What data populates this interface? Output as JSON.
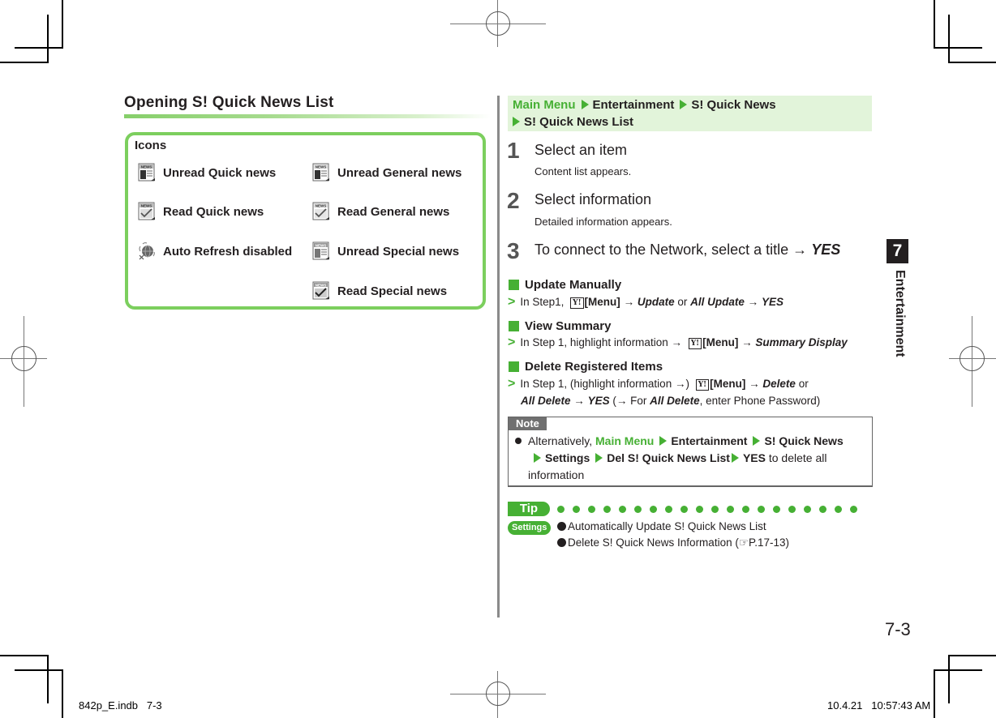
{
  "left_section": {
    "title": "Opening S! Quick News List",
    "icons_box": {
      "heading": "Icons",
      "items": [
        {
          "icon": "newspaper-unread-icon",
          "label": "Unread Quick news"
        },
        {
          "icon": "newspaper-read-icon",
          "label": "Read Quick news"
        },
        {
          "icon": "globe-disabled-icon",
          "label": "Auto Refresh disabled"
        },
        {
          "icon": "newspaper-unread-icon",
          "label": "Unread General news"
        },
        {
          "icon": "newspaper-read-icon",
          "label": "Read General news"
        },
        {
          "icon": "newspaper-unread-icon",
          "label": "Unread Special news"
        },
        {
          "icon": "newspaper-read-icon",
          "label": "Read Special news"
        }
      ]
    }
  },
  "breadcrumb": {
    "items": [
      "Main Menu",
      "Entertainment",
      "S! Quick News",
      "S! Quick News List"
    ]
  },
  "steps": [
    {
      "number": "1",
      "title": "Select an item",
      "desc": "Content list appears."
    },
    {
      "number": "2",
      "title": "Select information",
      "desc": "Detailed information appears."
    },
    {
      "number": "3",
      "title": "To connect to the Network, select a title",
      "arrow": "→",
      "emph": "YES"
    }
  ],
  "subsections": {
    "update_manually": {
      "heading": "Update Manually",
      "prefix": "In Step1,",
      "key": "Y!",
      "menu": "[Menu]",
      "arrow": "→",
      "opt1": "Update",
      "or": "or",
      "opt2": "All Update",
      "confirm": "YES"
    },
    "view_summary": {
      "heading": "View Summary",
      "prefix": "In Step 1, highlight information",
      "key": "Y!",
      "menu": "[Menu]",
      "arrow": "→",
      "opt": "Summary Display"
    },
    "delete_items": {
      "heading": "Delete Registered Items",
      "prefix": "In Step 1, (highlight information",
      "close_paren": ")",
      "key": "Y!",
      "menu": "[Menu]",
      "arrow": "→",
      "opt1": "Delete",
      "or": "or",
      "opt2": "All Delete",
      "confirm": "YES",
      "paren_open": "(",
      "for_text": "For",
      "for_emph": "All Delete",
      "tail": ", enter Phone Password)"
    }
  },
  "note": {
    "tag": "Note",
    "intro": "Alternatively,",
    "path": [
      "Main Menu",
      "Entertainment",
      "S! Quick News",
      "Settings",
      "Del S! Quick News List",
      "YES"
    ],
    "tail": "to delete all",
    "tail2": "information"
  },
  "tip": {
    "tag": "Tip",
    "settings_tag": "Settings",
    "items": [
      "Automatically Update S! Quick News List",
      "Delete S! Quick News Information ("
    ],
    "ref_icon": "pointing-hand-icon",
    "ref": "P.17-13)"
  },
  "chapter": {
    "number": "7",
    "label": "Entertainment"
  },
  "page_number": "7-3",
  "slug": {
    "file": "842p_E.indb   7-3",
    "timestamp": "10.4.21   10:57:43 AM"
  },
  "colors": {
    "accent_green": "#46b034",
    "box_border": "#7ccf5e",
    "breadcrumb_bg": "#e2f4da",
    "note_tag": "#707070"
  }
}
